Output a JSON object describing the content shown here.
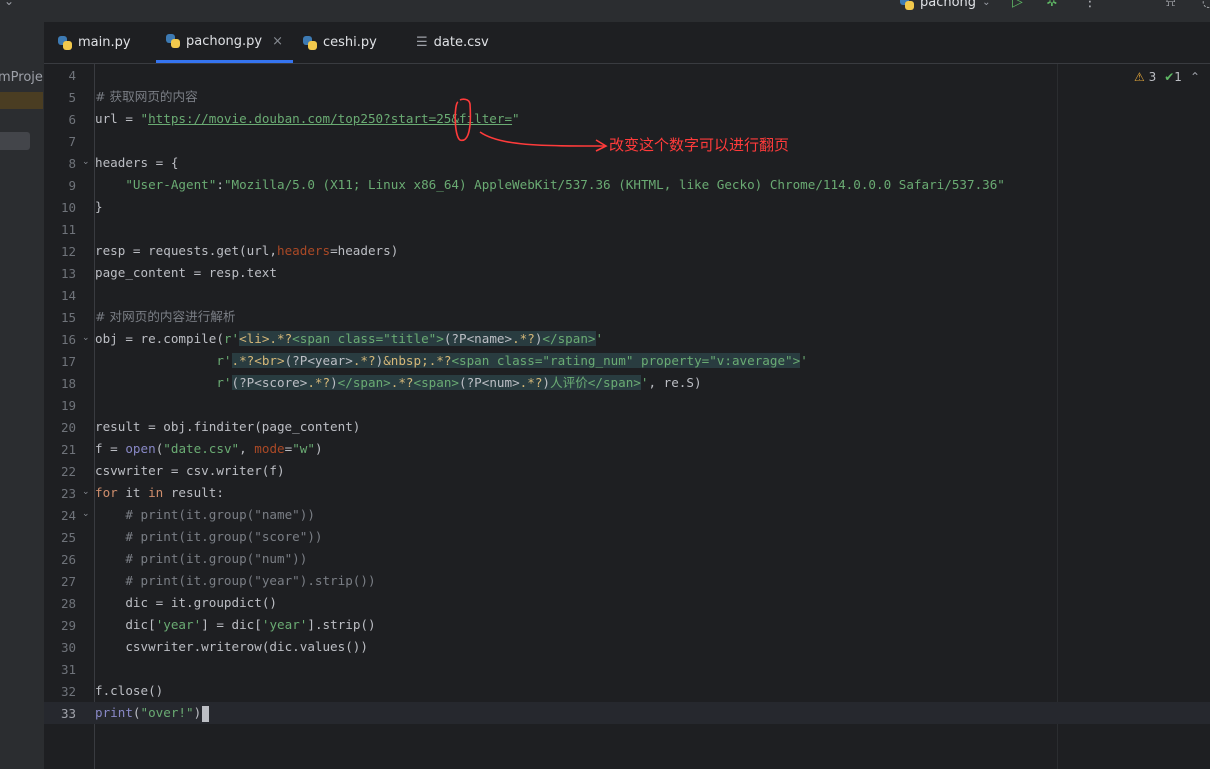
{
  "toolbar": {
    "run_config": "pachong",
    "icons": [
      "chevron-down-icon",
      "run-icon",
      "debug-icon",
      "more-icon",
      "add-user-icon",
      "search-icon"
    ]
  },
  "sidebar": {
    "project_label": "mProje"
  },
  "tabs": [
    {
      "label": "main.py",
      "icon": "python-file-icon",
      "active": false
    },
    {
      "label": "pachong.py",
      "icon": "python-file-icon",
      "active": true
    },
    {
      "label": "ceshi.py",
      "icon": "python-file-icon",
      "active": false
    },
    {
      "label": "date.csv",
      "icon": "csv-file-icon",
      "active": false
    }
  ],
  "inspection": {
    "warnings": "3",
    "ok": "1"
  },
  "annotation": {
    "note": "改变这个数字可以进行翻页",
    "color": "#ff3b3b"
  },
  "editor": {
    "line_numbers": [
      "4",
      "5",
      "6",
      "7",
      "8",
      "9",
      "10",
      "11",
      "12",
      "13",
      "14",
      "15",
      "16",
      "17",
      "18",
      "19",
      "20",
      "21",
      "22",
      "23",
      "24",
      "25",
      "26",
      "27",
      "28",
      "29",
      "30",
      "31",
      "32",
      "33"
    ],
    "current_line": "33",
    "lines": {
      "l5_comment": "# 获取网页的内容",
      "l6_a": "url = ",
      "l6_q1": "\"",
      "l6_url": "https://movie.douban.com/top250?start=25&filter=",
      "l6_q2": "\"",
      "l8": "headers = {",
      "l9_key": "\"User-Agent\"",
      "l9_colon": ":",
      "l9_val": "\"Mozilla/5.0 (X11; Linux x86_64) AppleWebKit/537.36 (KHTML, like Gecko) Chrome/114.0.0.0 Safari/537.36\"",
      "l10": "}",
      "l12_a": "resp = requests.get(url,",
      "l12_prm": "headers",
      "l12_b": "=headers)",
      "l13": "page_content = resp.text",
      "l15_comment": "# 对网页的内容进行解析",
      "l16_a": "obj = re.compile(",
      "l16_r": "r'",
      "l16_rx1": "<li>",
      "l16_rx2": ".*?",
      "l16_rx3": "<span class=\"title\">",
      "l16_rx4": "(?P<name>",
      "l16_rx5": ".*?",
      "l16_rx6": ")",
      "l16_rx7": "</span>",
      "l16_end": "'",
      "l17_r": "r'",
      "l17_rx1": ".*?",
      "l17_rx2": "<br>",
      "l17_rx3": "(?P<year>",
      "l17_rx4": ".*?",
      "l17_rx5": ")",
      "l17_rx6": "&nbsp;",
      "l17_rx7": ".*?",
      "l17_rx8": "<span class=\"rating_num\" property=\"v:average\">",
      "l17_end": "'",
      "l18_r": "r'",
      "l18_rx1": "(?P<score>",
      "l18_rx2": ".*?",
      "l18_rx3": ")",
      "l18_rx4": "</span>",
      "l18_rx5": ".*?",
      "l18_rx6": "<span>",
      "l18_rx7": "(?P<num>",
      "l18_rx8": ".*?",
      "l18_rx9": ")",
      "l18_rx10": "人评价",
      "l18_rx11": "</span>",
      "l18_end": "'",
      "l18_tail": ", re.S)",
      "l20": "result = obj.finditer(page_content)",
      "l21_a": "f = ",
      "l21_open": "open",
      "l21_b": "(",
      "l21_s1": "\"date.csv\"",
      "l21_c": ", ",
      "l21_prm": "mode",
      "l21_d": "=",
      "l21_s2": "\"w\"",
      "l21_e": ")",
      "l22": "csvwriter = csv.writer(f)",
      "l23_for": "for",
      "l23_a": " it ",
      "l23_in": "in",
      "l23_b": " result:",
      "l24": "# print(it.group(\"name\"))",
      "l25": "# print(it.group(\"score\"))",
      "l26": "# print(it.group(\"num\"))",
      "l27": "# print(it.group(\"year\").strip())",
      "l28": "dic = it.groupdict()",
      "l29_a": "dic[",
      "l29_s1": "'year'",
      "l29_b": "] = dic[",
      "l29_s2": "'year'",
      "l29_c": "].strip()",
      "l30": "csvwriter.writerow(dic.values())",
      "l32": "f.close()",
      "l33_print": "print",
      "l33_a": "(",
      "l33_s": "\"over!\"",
      "l33_b": ")"
    }
  }
}
